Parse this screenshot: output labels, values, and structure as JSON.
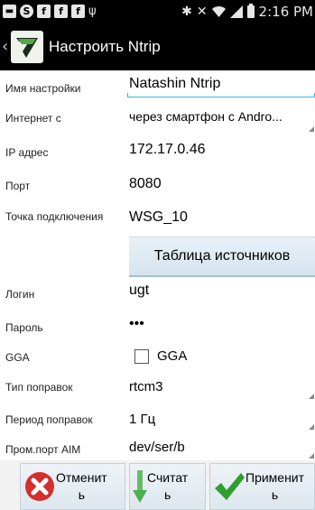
{
  "status_bar": {
    "icons": [
      "S",
      "f",
      "f",
      "f"
    ],
    "time": "2:16 PM"
  },
  "action_bar": {
    "title": "Настроить Ntrip"
  },
  "form": {
    "name_label": "Имя настройки",
    "name_value": "Natashin Ntrip",
    "internet_label": "Интернет с",
    "internet_value": "через смартфон с Andro...",
    "ip_label": "IP адрес",
    "ip_value": "172.17.0.46",
    "port_label": "Порт",
    "port_value": "8080",
    "mountpoint_label": "Точка подключения",
    "mountpoint_value": "WSG_10",
    "sources_button": "Таблица источников",
    "login_label": "Логин",
    "login_value": "ugt",
    "password_label": "Пароль",
    "password_value": "•••",
    "gga_label": "GGA",
    "gga_checkbox_label": "GGA",
    "gga_checked": false,
    "correction_type_label": "Тип поправок",
    "correction_type_value": "rtcm3",
    "correction_period_label": "Период поправок",
    "correction_period_value": "1 Гц",
    "aim_port_label": "Пром.порт AIM",
    "aim_port_value": "dev/ser/b"
  },
  "buttons": {
    "cancel": "Отменит\nь",
    "read": "Считат\nь",
    "apply": "Применит\nь"
  },
  "colors": {
    "accent": "#33b5e5",
    "cancel_icon": "#d32f2f",
    "read_icon": "#4caf50",
    "apply_icon": "#2e9e2e"
  }
}
